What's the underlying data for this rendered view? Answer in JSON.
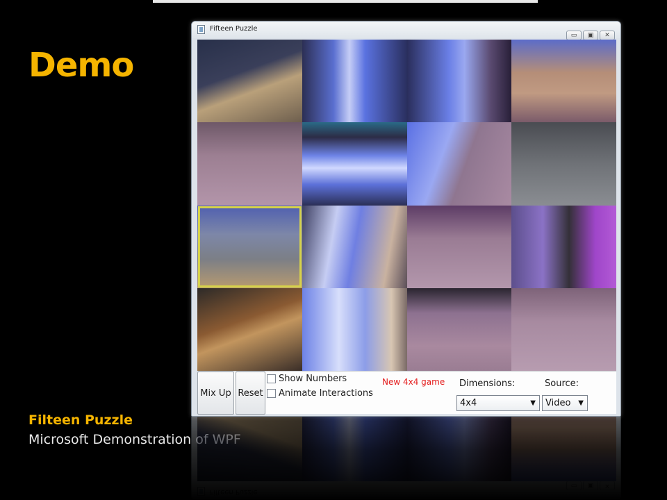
{
  "slide": {
    "title": "Demo",
    "caption_title": "Filteen Puzzle",
    "caption_subtitle": "Microsoft Demonstration of WPF",
    "accent_color": "#f5b400"
  },
  "window": {
    "title": "Fifteen Puzzle",
    "controls": [
      {
        "name": "minimize",
        "glyph": "▭"
      },
      {
        "name": "maximize",
        "glyph": "▣"
      },
      {
        "name": "close",
        "glyph": "✕"
      }
    ]
  },
  "board": {
    "rows": 4,
    "cols": 4,
    "selected_tile": 8,
    "selection_color": "#d6d24a"
  },
  "controls": {
    "mix_up_label": "Mix Up",
    "reset_label": "Reset",
    "show_numbers_label": "Show Numbers",
    "animate_label": "Animate Interactions",
    "status_text": "New 4x4 game",
    "status_color": "#e41c1c",
    "dimensions_label": "Dimensions:",
    "dimensions_value": "4x4",
    "source_label": "Source:",
    "source_value": "Video"
  }
}
